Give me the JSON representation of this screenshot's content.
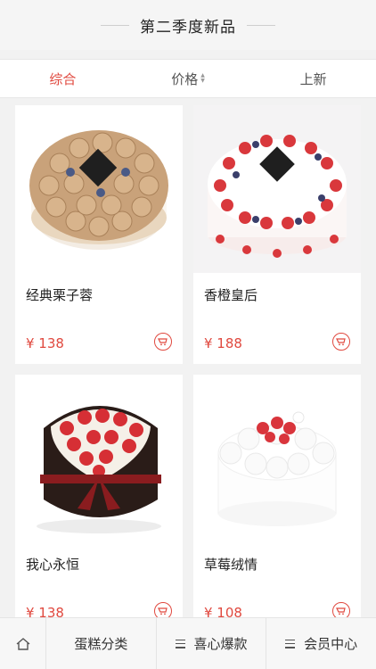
{
  "header": {
    "title": "第二季度新品"
  },
  "sort_tabs": [
    {
      "label": "综合",
      "active": true
    },
    {
      "label": "价格",
      "active": false
    },
    {
      "label": "上新",
      "active": false
    }
  ],
  "products": [
    {
      "name": "经典栗子蓉",
      "price": "¥ 138"
    },
    {
      "name": "香橙皇后",
      "price": "¥ 188"
    },
    {
      "name": "我心永恒",
      "price": "¥ 138"
    },
    {
      "name": "草莓绒情",
      "price": "¥ 108"
    }
  ],
  "footer": {
    "items": [
      {
        "label": "蛋糕分类"
      },
      {
        "label": "喜心爆款"
      },
      {
        "label": "会员中心"
      }
    ]
  },
  "colors": {
    "accent": "#e0493f"
  },
  "icons": {
    "home": "home-icon",
    "menu": "menu-icon",
    "cart": "cart-icon"
  }
}
